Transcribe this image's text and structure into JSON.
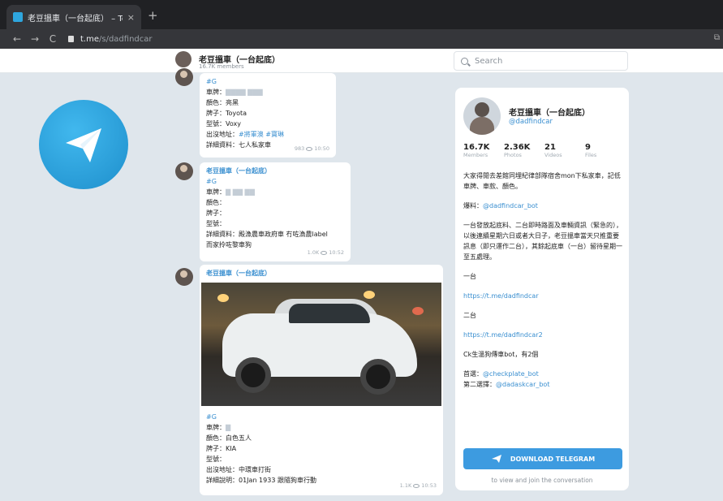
{
  "browser": {
    "tab_title": "老豆搵車（一台起底） – Telegr...",
    "tab_close": "×",
    "new_tab": "+",
    "back": "←",
    "forward": "→",
    "reload": "C",
    "url_host": "t.me",
    "url_path": "/s/dadfindcar"
  },
  "header": {
    "channel_title": "老豆搵車（一台起底）",
    "members": "16.7K members",
    "search_placeholder": "Search"
  },
  "messages": [
    {
      "lines": [
        "#G",
        "車牌：",
        "顏色：亮黑",
        "牌子：Toyota",
        "型號：Voxy",
        "出沒地址：",
        "詳細資料：七人私家車"
      ],
      "tag": "#G",
      "address_links": "#將軍澳 #寶琳",
      "views": "983",
      "time": "10:50"
    },
    {
      "name": "老豆搵車（一台起底）",
      "tag": "#G",
      "plate": "車牌：",
      "color": "顏色：",
      "brand": "牌子：",
      "model": "型號：",
      "detail1": "詳細資料：殿漁農車政府車 冇咗漁農label",
      "detail2": "而家拎咗黎車狗",
      "views": "1.0K",
      "time": "10:52"
    },
    {
      "name": "老豆搵車（一台起底）",
      "tag": "#G",
      "plate": "車牌：",
      "color": "顏色：白色五人",
      "brand": "牌子：KIA",
      "model": "型號：",
      "address": "出沒地址：中環車打街",
      "detail": "詳細說明：01Jan 1933 跟隨狗車行動",
      "views": "1.1K",
      "time": "10:53"
    }
  ],
  "card": {
    "name": "老豆搵車（一台起底）",
    "handle": "@dadfindcar",
    "stats": [
      {
        "num": "16.7K",
        "label": "Members"
      },
      {
        "num": "2.36K",
        "label": "Photos"
      },
      {
        "num": "21",
        "label": "Videos"
      },
      {
        "num": "9",
        "label": "Files"
      }
    ],
    "desc1": "大家得閒去差館同埋紀律部隊宿舍mon下私家車，記低車牌、車款、顏色。",
    "desc2_label": "爆料：",
    "desc2_link": "@dadfindcar_bot",
    "desc3": "一台發放起底料、二台即時路面及車輛資訊（緊急的），以後連續星期六日或者大日子，老豆搵車當天只推重要訊息（即只運作二台），其餘起底車（一台）留待星期一至五處理。",
    "desc4": "一台",
    "desc5": "https://t.me/dadfindcar",
    "desc6": "二台",
    "desc7": "https://t.me/dadfindcar2",
    "desc8": "Ck生溫狗傳車bot，有2個",
    "desc9_label": "首選：",
    "desc9_link": "@checkplate_bot",
    "desc10_label": "第二選擇：",
    "desc10_link": "@dadaskcar_bot",
    "download_label": "DOWNLOAD TELEGRAM",
    "download_sub": "to view and join the conversation"
  }
}
